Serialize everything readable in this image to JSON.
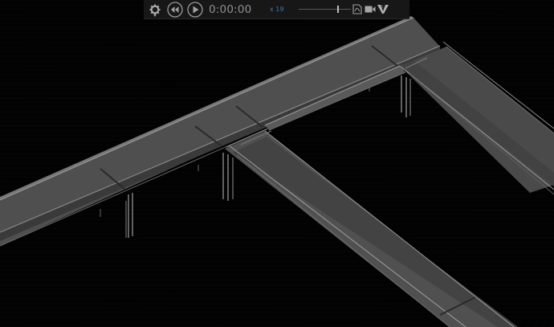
{
  "toolbar": {
    "time": "0:00:00",
    "speed": "x 19",
    "speed_level": 0.76
  },
  "icons": {
    "settings": "gear-icon",
    "settings_menu": "caret-down-icon",
    "rewind": "skip-back-icon",
    "play": "play-icon",
    "pdf": "pdf-export-icon",
    "camera": "video-camera-icon",
    "brand": "v-logo-icon"
  }
}
